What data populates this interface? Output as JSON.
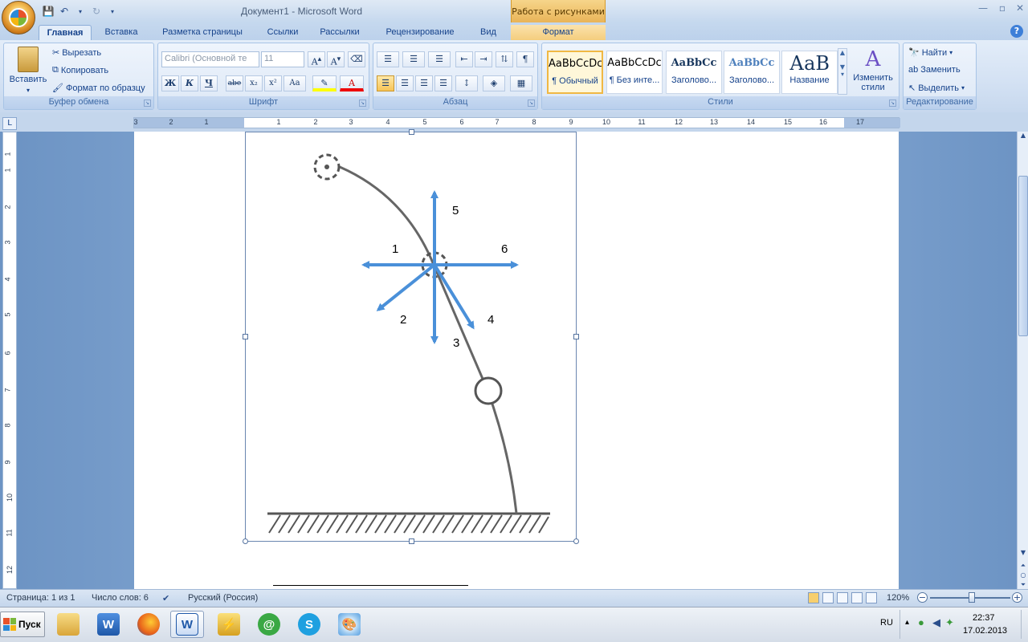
{
  "window": {
    "title": "Документ1 - Microsoft Word",
    "context_tab_group": "Работа с рисунками"
  },
  "tabs": [
    {
      "label": "Главная",
      "active": true
    },
    {
      "label": "Вставка"
    },
    {
      "label": "Разметка страницы"
    },
    {
      "label": "Ссылки"
    },
    {
      "label": "Рассылки"
    },
    {
      "label": "Рецензирование"
    },
    {
      "label": "Вид"
    },
    {
      "label": "Формат",
      "contextual": true
    }
  ],
  "clipboard": {
    "paste": "Вставить",
    "cut": "Вырезать",
    "copy": "Копировать",
    "format_painter": "Формат по образцу",
    "title": "Буфер обмена"
  },
  "font": {
    "name": "Calibri (Основной те",
    "size": "11",
    "title": "Шрифт",
    "bold": "Ж",
    "italic": "К",
    "underline": "Ч",
    "strike": "abe",
    "subscript": "x₂",
    "superscript": "x²",
    "case": "Aa"
  },
  "paragraph": {
    "title": "Абзац"
  },
  "styles": {
    "title": "Стили",
    "items": [
      {
        "preview": "AaBbCcDc",
        "name": "¶ Обычный",
        "selected": true
      },
      {
        "preview": "AaBbCcDc",
        "name": "¶ Без инте..."
      },
      {
        "preview": "AaBbCc",
        "name": "Заголово..."
      },
      {
        "preview": "AaBbCc",
        "name": "Заголово..."
      },
      {
        "preview": "АаВ",
        "name": "Название"
      }
    ],
    "change": "Изменить стили"
  },
  "editing": {
    "title": "Редактирование",
    "find": "Найти",
    "replace": "Заменить",
    "select": "Выделить"
  },
  "ruler": {
    "h_numbers": [
      "3",
      "2",
      "1",
      "1",
      "2",
      "3",
      "4",
      "5",
      "6",
      "7",
      "8",
      "9",
      "10",
      "11",
      "12",
      "13",
      "14",
      "15",
      "16",
      "17"
    ],
    "v_numbers": [
      "1",
      "1",
      "2",
      "3",
      "4",
      "5",
      "6",
      "7",
      "8",
      "9",
      "10",
      "11",
      "12"
    ],
    "corner": "L"
  },
  "figure": {
    "labels": [
      "1",
      "2",
      "3",
      "4",
      "5",
      "6"
    ]
  },
  "status": {
    "page": "Страница: 1 из 1",
    "words": "Число слов: 6",
    "language": "Русский (Россия)",
    "zoom": "120%"
  },
  "taskbar": {
    "start": "Пуск",
    "lang": "RU",
    "time": "22:37",
    "date": "17.02.2013"
  },
  "colors": {
    "accent": "#4a90d9",
    "ribbon": "#dfe9f5",
    "context": "#f0c46a"
  }
}
